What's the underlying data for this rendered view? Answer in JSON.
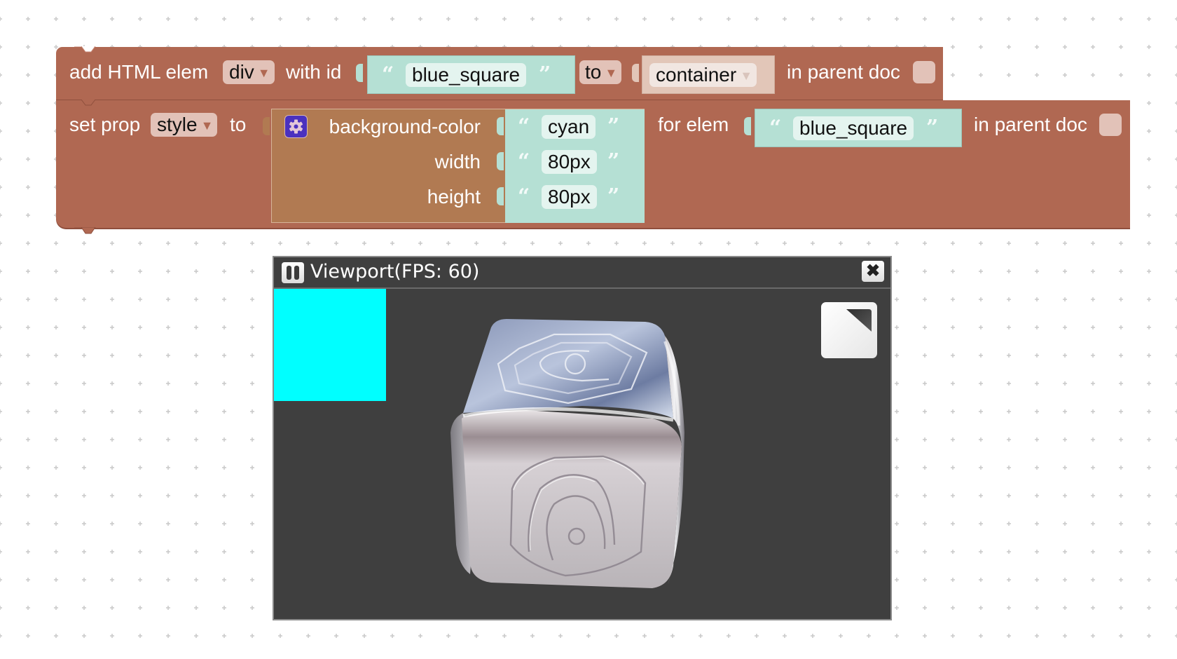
{
  "workspace": {
    "background": "#ffffff",
    "grid_color": "#c9c9c9"
  },
  "block_add_elem": {
    "label_prefix": "add HTML elem",
    "tag_dropdown": "div",
    "label_with_id": "with id",
    "id_value": "blue_square",
    "to_dropdown": "to",
    "parent_dropdown": "container",
    "label_parent_doc": "in parent doc",
    "parent_doc_checked": false,
    "color": "#b06852"
  },
  "block_set_prop": {
    "label_prefix": "set prop",
    "prop_dropdown": "style",
    "label_to": "to",
    "map": {
      "rows": [
        {
          "key": "background-color",
          "value": "cyan"
        },
        {
          "key": "width",
          "value": "80px"
        },
        {
          "key": "height",
          "value": "80px"
        }
      ],
      "gear_icon": "gear-icon",
      "color": "#b17a52"
    },
    "label_for_elem": "for elem",
    "elem_value": "blue_square",
    "label_parent_doc": "in parent doc",
    "parent_doc_checked": false
  },
  "quotes": {
    "open": "“",
    "close": "”"
  },
  "dropdown_arrow": "▼",
  "viewport": {
    "title": "Viewport(FPS: 60)",
    "pause_icon": "pause-icon",
    "close_icon": "✖",
    "resize_icon": "resize-icon",
    "rendered_square_color": "#00ffff",
    "background": "#3f3f3f"
  }
}
